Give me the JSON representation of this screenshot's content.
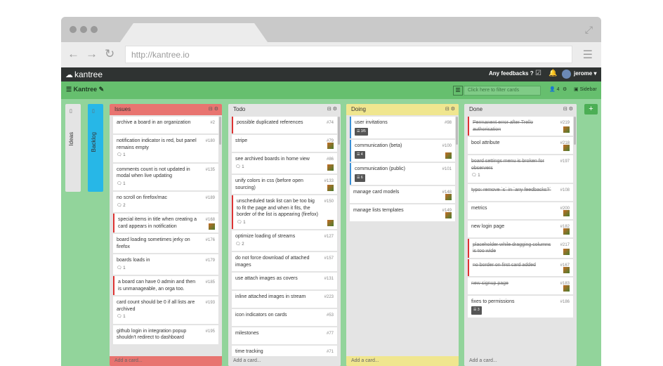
{
  "browser": {
    "url": "http://kantree.io",
    "back_icon": "←",
    "forward_icon": "→",
    "reload_icon": "↻",
    "menu_icon": "☰",
    "expand_icon": "⤢"
  },
  "topbar": {
    "logo": "kantree",
    "feedback": "Any feedbacks ?",
    "user": "jerome"
  },
  "boardbar": {
    "board_name": "Kantree",
    "filter_placeholder": "Click here to filter cards",
    "members_count": "4",
    "sidebar_label": "Sidebar"
  },
  "collapsed_columns": [
    {
      "label": "Ideas",
      "color": "#e4e4e4"
    },
    {
      "label": "Backlog",
      "color": "#27b7e7"
    }
  ],
  "columns": [
    {
      "title": "Issues",
      "header_color": "#e87470",
      "add_label": "Add a card...",
      "cards": [
        {
          "text": "archive a board in an organization",
          "num": "#2"
        },
        {
          "text": "notification indicator is red, but panel remains empty",
          "num": "#180",
          "meta": "1"
        },
        {
          "text": "comments count is not updated in modal when live updating",
          "num": "#135",
          "meta": "1"
        },
        {
          "text": "no scroll on firefox/mac",
          "num": "#189",
          "meta": "2"
        },
        {
          "text": "special items in title when creating a card appears in notification",
          "num": "#168",
          "thumb": true,
          "style": "red"
        },
        {
          "text": "board loading sometimes jerky on firefox",
          "num": "#176"
        },
        {
          "text": "boards loads in",
          "num": "#179",
          "meta": "1"
        },
        {
          "text": "a board can have 0 admin and then is unmanageable, an orga too.",
          "num": "#185",
          "style": "red"
        },
        {
          "text": "card count should be 0 if all lists are archived",
          "num": "#193",
          "meta": "1"
        },
        {
          "text": "github login in integration popup shouldn't redirect to dashboard",
          "num": "#195"
        }
      ]
    },
    {
      "title": "Todo",
      "header_color": "#e4e4e4",
      "add_label": "Add a card...",
      "cards": [
        {
          "text": "possible duplicated references",
          "num": "#74",
          "style": "red"
        },
        {
          "text": "stripe",
          "num": "#79",
          "thumb": true
        },
        {
          "text": "see archived boards in home view",
          "num": "#86",
          "meta": "1",
          "thumb": true
        },
        {
          "text": "unify colors in css (before open sourcing)",
          "num": "#133",
          "thumb": true
        },
        {
          "text": "unscheduled task list can be too big to fit the page and when it fits, the border of the list is appearing (firefox)",
          "num": "#150",
          "meta": "1",
          "thumb": true,
          "style": "red"
        },
        {
          "text": "optimize loading of streams",
          "num": "#127",
          "meta": "2"
        },
        {
          "text": "do not force download of attached images",
          "num": "#157"
        },
        {
          "text": "use attach images as covers",
          "num": "#131"
        },
        {
          "text": "inline attached images in stream",
          "num": "#223"
        },
        {
          "text": "icon indicators on cards",
          "num": "#53"
        },
        {
          "text": "milestones",
          "num": "#77"
        },
        {
          "text": "time tracking",
          "num": "#71"
        }
      ]
    },
    {
      "title": "Doing",
      "header_color": "#f0e68f",
      "add_label": "Add a card...",
      "cards": [
        {
          "text": "user invitations",
          "num": "#98",
          "badge": "3/5",
          "style": "blue"
        },
        {
          "text": "communication (beta)",
          "num": "#100",
          "badge": "4",
          "thumb": true,
          "style": "blue"
        },
        {
          "text": "communication (public)",
          "num": "#101",
          "badge": "6",
          "style": "blue"
        },
        {
          "text": "manage card models",
          "num": "#148",
          "thumb": true
        },
        {
          "text": "manage lists templates",
          "num": "#149",
          "thumb": true
        }
      ]
    },
    {
      "title": "Done",
      "header_color": "#e4e4e4",
      "add_label": "Add a card...",
      "cards": [
        {
          "text": "Permanent error after Trello authorisation",
          "num": "#219",
          "thumb": true,
          "style": "red",
          "done": true
        },
        {
          "text": "bool attribute",
          "num": "#218",
          "thumb": true
        },
        {
          "text": "board settings menu is broken for observers",
          "num": "#197",
          "meta": "1",
          "done": true
        },
        {
          "text": "typo: remove `s` in `any feedbacks?`",
          "num": "#108",
          "done": true
        },
        {
          "text": "metrics",
          "num": "#200",
          "thumb": true
        },
        {
          "text": "new login page",
          "num": "#182",
          "thumb": true
        },
        {
          "text": "placeholder while dragging columns is too wide",
          "num": "#217",
          "thumb": true,
          "style": "red",
          "done": true
        },
        {
          "text": "no border on first card added",
          "num": "#167",
          "thumb": true,
          "style": "red",
          "done": true
        },
        {
          "text": "new signup page",
          "num": "#183",
          "thumb": true,
          "done": true
        },
        {
          "text": "fixes to permissions",
          "num": "#186",
          "badge": "3"
        }
      ]
    }
  ]
}
